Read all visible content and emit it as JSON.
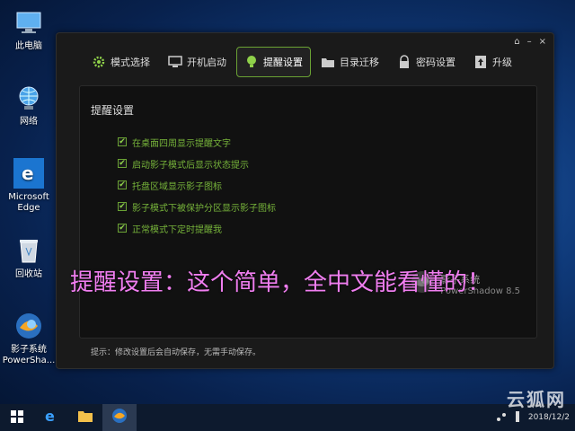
{
  "desktop": {
    "icons": [
      {
        "label": "此电脑"
      },
      {
        "label": "网络"
      },
      {
        "label": "Microsoft Edge"
      },
      {
        "label": "回收站"
      },
      {
        "label": "影子系统 PowerSha..."
      }
    ]
  },
  "window": {
    "controls": {
      "pin": "⌂",
      "minimize": "–",
      "close": "×"
    },
    "tabs": [
      {
        "label": "模式选择",
        "icon": "gear-icon"
      },
      {
        "label": "开机启动",
        "icon": "monitor-icon"
      },
      {
        "label": "提醒设置",
        "icon": "bulb-icon",
        "active": true
      },
      {
        "label": "目录迁移",
        "icon": "folder-icon"
      },
      {
        "label": "密码设置",
        "icon": "lock-icon"
      },
      {
        "label": "升级",
        "icon": "upgrade-icon"
      }
    ],
    "panel_title": "提醒设置",
    "options": [
      {
        "label": "在桌面四周显示提醒文字",
        "checked": true
      },
      {
        "label": "启动影子模式后显示状态提示",
        "checked": true
      },
      {
        "label": "托盘区域显示影子图标",
        "checked": true
      },
      {
        "label": "影子模式下被保护分区显示影子图标",
        "checked": true
      },
      {
        "label": "正常模式下定时提醒我",
        "checked": true
      }
    ],
    "caption": "提醒设置：这个简单，全中文能看懂的！",
    "brand": {
      "name": "影子系统",
      "product": "PowerShadow",
      "version": "8.5"
    },
    "footer_tip": "提示：修改设置后会自动保存，无需手动保存。"
  },
  "taskbar": {
    "clock_date": "2018/12/2",
    "watermark": "云狐网"
  },
  "colors": {
    "accent_green": "#6aa234",
    "caption_pink": "#f07ef0"
  }
}
